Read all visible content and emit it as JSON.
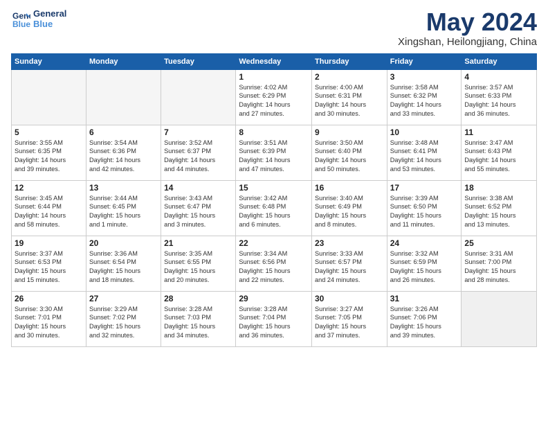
{
  "logo": {
    "line1": "General",
    "line2": "Blue"
  },
  "title": "May 2024",
  "subtitle": "Xingshan, Heilongjiang, China",
  "days_header": [
    "Sunday",
    "Monday",
    "Tuesday",
    "Wednesday",
    "Thursday",
    "Friday",
    "Saturday"
  ],
  "weeks": [
    [
      {
        "num": "",
        "info": "",
        "empty": true
      },
      {
        "num": "",
        "info": "",
        "empty": true
      },
      {
        "num": "",
        "info": "",
        "empty": true
      },
      {
        "num": "1",
        "info": "Sunrise: 4:02 AM\nSunset: 6:29 PM\nDaylight: 14 hours\nand 27 minutes."
      },
      {
        "num": "2",
        "info": "Sunrise: 4:00 AM\nSunset: 6:31 PM\nDaylight: 14 hours\nand 30 minutes."
      },
      {
        "num": "3",
        "info": "Sunrise: 3:58 AM\nSunset: 6:32 PM\nDaylight: 14 hours\nand 33 minutes."
      },
      {
        "num": "4",
        "info": "Sunrise: 3:57 AM\nSunset: 6:33 PM\nDaylight: 14 hours\nand 36 minutes."
      }
    ],
    [
      {
        "num": "5",
        "info": "Sunrise: 3:55 AM\nSunset: 6:35 PM\nDaylight: 14 hours\nand 39 minutes."
      },
      {
        "num": "6",
        "info": "Sunrise: 3:54 AM\nSunset: 6:36 PM\nDaylight: 14 hours\nand 42 minutes."
      },
      {
        "num": "7",
        "info": "Sunrise: 3:52 AM\nSunset: 6:37 PM\nDaylight: 14 hours\nand 44 minutes."
      },
      {
        "num": "8",
        "info": "Sunrise: 3:51 AM\nSunset: 6:39 PM\nDaylight: 14 hours\nand 47 minutes."
      },
      {
        "num": "9",
        "info": "Sunrise: 3:50 AM\nSunset: 6:40 PM\nDaylight: 14 hours\nand 50 minutes."
      },
      {
        "num": "10",
        "info": "Sunrise: 3:48 AM\nSunset: 6:41 PM\nDaylight: 14 hours\nand 53 minutes."
      },
      {
        "num": "11",
        "info": "Sunrise: 3:47 AM\nSunset: 6:43 PM\nDaylight: 14 hours\nand 55 minutes."
      }
    ],
    [
      {
        "num": "12",
        "info": "Sunrise: 3:45 AM\nSunset: 6:44 PM\nDaylight: 14 hours\nand 58 minutes."
      },
      {
        "num": "13",
        "info": "Sunrise: 3:44 AM\nSunset: 6:45 PM\nDaylight: 15 hours\nand 1 minute."
      },
      {
        "num": "14",
        "info": "Sunrise: 3:43 AM\nSunset: 6:47 PM\nDaylight: 15 hours\nand 3 minutes."
      },
      {
        "num": "15",
        "info": "Sunrise: 3:42 AM\nSunset: 6:48 PM\nDaylight: 15 hours\nand 6 minutes."
      },
      {
        "num": "16",
        "info": "Sunrise: 3:40 AM\nSunset: 6:49 PM\nDaylight: 15 hours\nand 8 minutes."
      },
      {
        "num": "17",
        "info": "Sunrise: 3:39 AM\nSunset: 6:50 PM\nDaylight: 15 hours\nand 11 minutes."
      },
      {
        "num": "18",
        "info": "Sunrise: 3:38 AM\nSunset: 6:52 PM\nDaylight: 15 hours\nand 13 minutes."
      }
    ],
    [
      {
        "num": "19",
        "info": "Sunrise: 3:37 AM\nSunset: 6:53 PM\nDaylight: 15 hours\nand 15 minutes."
      },
      {
        "num": "20",
        "info": "Sunrise: 3:36 AM\nSunset: 6:54 PM\nDaylight: 15 hours\nand 18 minutes."
      },
      {
        "num": "21",
        "info": "Sunrise: 3:35 AM\nSunset: 6:55 PM\nDaylight: 15 hours\nand 20 minutes."
      },
      {
        "num": "22",
        "info": "Sunrise: 3:34 AM\nSunset: 6:56 PM\nDaylight: 15 hours\nand 22 minutes."
      },
      {
        "num": "23",
        "info": "Sunrise: 3:33 AM\nSunset: 6:57 PM\nDaylight: 15 hours\nand 24 minutes."
      },
      {
        "num": "24",
        "info": "Sunrise: 3:32 AM\nSunset: 6:59 PM\nDaylight: 15 hours\nand 26 minutes."
      },
      {
        "num": "25",
        "info": "Sunrise: 3:31 AM\nSunset: 7:00 PM\nDaylight: 15 hours\nand 28 minutes."
      }
    ],
    [
      {
        "num": "26",
        "info": "Sunrise: 3:30 AM\nSunset: 7:01 PM\nDaylight: 15 hours\nand 30 minutes."
      },
      {
        "num": "27",
        "info": "Sunrise: 3:29 AM\nSunset: 7:02 PM\nDaylight: 15 hours\nand 32 minutes."
      },
      {
        "num": "28",
        "info": "Sunrise: 3:28 AM\nSunset: 7:03 PM\nDaylight: 15 hours\nand 34 minutes."
      },
      {
        "num": "29",
        "info": "Sunrise: 3:28 AM\nSunset: 7:04 PM\nDaylight: 15 hours\nand 36 minutes."
      },
      {
        "num": "30",
        "info": "Sunrise: 3:27 AM\nSunset: 7:05 PM\nDaylight: 15 hours\nand 37 minutes."
      },
      {
        "num": "31",
        "info": "Sunrise: 3:26 AM\nSunset: 7:06 PM\nDaylight: 15 hours\nand 39 minutes."
      },
      {
        "num": "",
        "info": "",
        "empty": true,
        "shaded": true
      }
    ]
  ]
}
